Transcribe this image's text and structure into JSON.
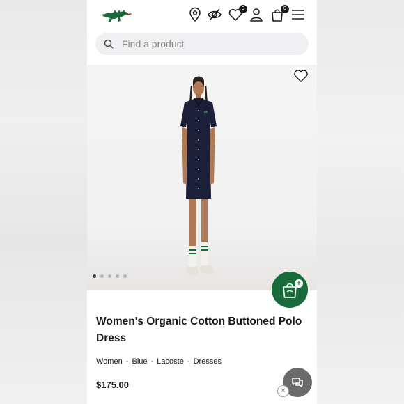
{
  "header": {
    "wishlist_count": "0",
    "cart_count": "0"
  },
  "search": {
    "placeholder": "Find a product"
  },
  "gallery": {
    "image_count": 5,
    "active_index": 0
  },
  "product": {
    "title": "Women's Organic Cotton Buttoned Polo Dress",
    "breadcrumbs": [
      "Women",
      "Blue",
      "Lacoste",
      "Dresses"
    ],
    "price": "$175.00"
  },
  "chat": {
    "close_label": "×"
  },
  "colors": {
    "brand_green": "#1a6b3c",
    "text": "#1a1a1a",
    "search_bg": "#f0f0f2"
  }
}
